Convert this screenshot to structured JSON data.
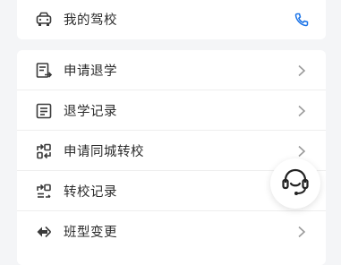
{
  "top_card": {
    "label": "我的驾校",
    "icon": "car-icon",
    "action_icon": "phone-icon"
  },
  "menu": [
    {
      "label": "申请退学",
      "icon": "withdraw-apply-icon"
    },
    {
      "label": "退学记录",
      "icon": "document-list-icon"
    },
    {
      "label": "申请同城转校",
      "icon": "transfer-apply-icon"
    },
    {
      "label": "转校记录",
      "icon": "transfer-record-icon"
    },
    {
      "label": "班型变更",
      "icon": "class-change-icon"
    }
  ],
  "floating": {
    "icon": "customer-service-icon"
  },
  "colors": {
    "accent": "#1a73e8",
    "text": "#2b2b2b",
    "chevron": "#9a9a9a"
  }
}
